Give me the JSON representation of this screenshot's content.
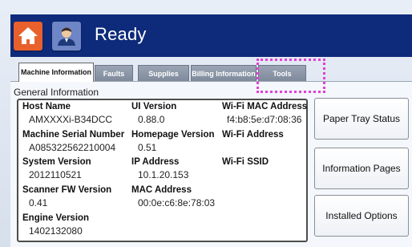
{
  "header": {
    "title": "Ready",
    "home_icon": "home-icon",
    "user_icon": "user-icon",
    "bar_color": "#0e2a7a",
    "home_color": "#e8612c",
    "user_color": "#6f86c6"
  },
  "tabs": [
    {
      "label": "Machine Information",
      "active": true
    },
    {
      "label": "Faults"
    },
    {
      "label": "Supplies"
    },
    {
      "label": "Billing Information"
    },
    {
      "label": "Tools"
    }
  ],
  "general": {
    "title": "General Information",
    "host_name_label": "Host Name",
    "host_name_value": "AMXXXXi-B34DCC",
    "serial_label": "Machine Serial Number",
    "serial_value": "A085322562210004",
    "system_version_label": "System Version",
    "system_version_value": "2012110521",
    "scanner_fw_label": "Scanner FW Version",
    "scanner_fw_value": "0.41",
    "engine_version_label": "Engine Version",
    "engine_version_value": "1402132080",
    "ui_version_label": "UI Version",
    "ui_version_value": "0.88.0",
    "homepage_version_label": "Homepage Version",
    "homepage_version_value": "0.51",
    "ip_label": "IP Address",
    "ip_value": "10.1.20.153",
    "mac_label": "MAC Address",
    "mac_value": "00:0e:c6:8e:78:03",
    "wifi_mac_label": "Wi-Fi MAC Address",
    "wifi_mac_value": "f4:b8:5e:d7:08:36",
    "wifi_address_label": "Wi-Fi Address",
    "wifi_ssid_label": "Wi-Fi SSID"
  },
  "side_buttons": {
    "paper_tray": "Paper Tray Status",
    "information_pages": "Information Pages",
    "installed_options": "Installed Options"
  },
  "highlight_color": "#e13fd6"
}
